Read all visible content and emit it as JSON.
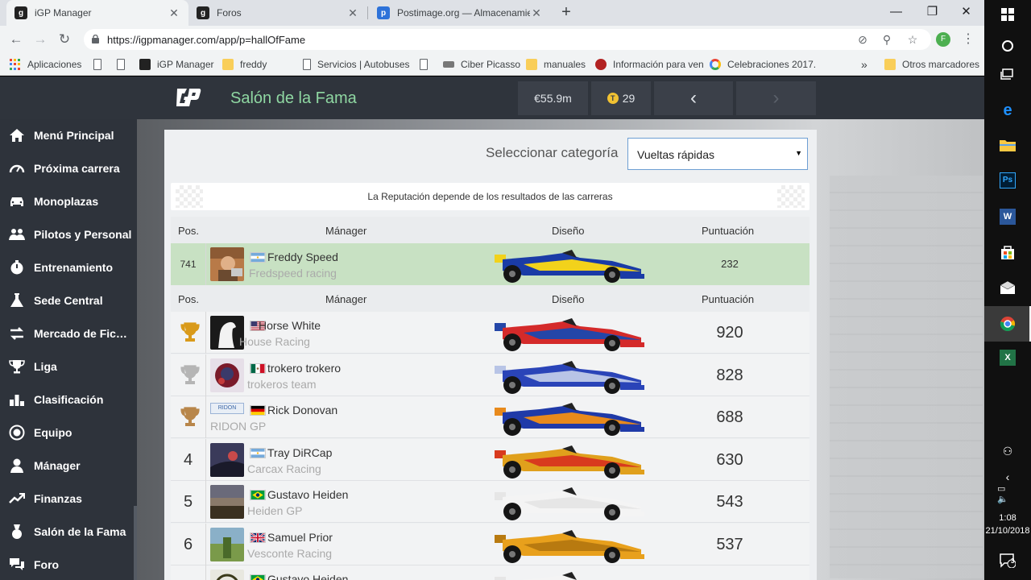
{
  "browser": {
    "tabs": [
      {
        "title": "iGP Manager",
        "favicon": "igp-favicon",
        "active": true
      },
      {
        "title": "Foros",
        "favicon": "igp-favicon",
        "active": false
      },
      {
        "title": "Postimage.org — Almacenamiento",
        "favicon": "postimage-favicon",
        "active": false
      }
    ],
    "url": "https://igpmanager.com/app/p=hallOfFame",
    "profile_initial": "F",
    "bookmarks": [
      {
        "label": "Aplicaciones",
        "icon": "apps-icon"
      },
      {
        "label": "",
        "icon": "page-icon"
      },
      {
        "label": "",
        "icon": "page-icon"
      },
      {
        "label": "iGP Manager",
        "icon": "igp-favicon"
      },
      {
        "label": "freddy",
        "icon": "folder-icon"
      },
      {
        "label": "Servicios | Autobuses",
        "icon": "page-icon"
      },
      {
        "label": "",
        "icon": "page-icon"
      },
      {
        "label": "Ciber Picasso",
        "icon": "site-icon"
      },
      {
        "label": "manuales",
        "icon": "folder-icon"
      },
      {
        "label": "Información para ven",
        "icon": "site-icon"
      },
      {
        "label": "Celebraciones 2017.",
        "icon": "google-icon"
      }
    ],
    "bookmarks_more": "»",
    "other_bookmarks": "Otros marcadores"
  },
  "site": {
    "title": "Salón de la Fama",
    "money": "€55.9m",
    "tokens": "29",
    "coin_symbol": "T",
    "prev_arrow": "‹",
    "next_arrow": "›"
  },
  "sidebar": {
    "items": [
      {
        "label": "Menú Principal",
        "icon": "home-icon"
      },
      {
        "label": "Próxima carrera",
        "icon": "speedometer-icon"
      },
      {
        "label": "Monoplazas",
        "icon": "car-icon"
      },
      {
        "label": "Pilotos y Personal",
        "icon": "people-icon"
      },
      {
        "label": "Entrenamiento",
        "icon": "stopwatch-icon"
      },
      {
        "label": "Sede Central",
        "icon": "flask-icon"
      },
      {
        "label": "Mercado de Fichajes",
        "icon": "transfer-icon"
      },
      {
        "label": "Liga",
        "icon": "trophy-icon"
      },
      {
        "label": "Clasificación",
        "icon": "bar-chart-icon"
      },
      {
        "label": "Equipo",
        "icon": "target-icon"
      },
      {
        "label": "Mánager",
        "icon": "user-icon"
      },
      {
        "label": "Finanzas",
        "icon": "trend-icon"
      },
      {
        "label": "Salón de la Fama",
        "icon": "medal-icon"
      },
      {
        "label": "Foro",
        "icon": "forum-icon"
      }
    ]
  },
  "hall": {
    "category_label": "Seleccionar categoría",
    "category_value": "Vueltas rápidas",
    "banner": "La Reputación depende de los resultados de las carreras",
    "headers": {
      "pos": "Pos.",
      "manager": "Mánager",
      "design": "Diseño",
      "score": "Puntuación"
    },
    "my_row": {
      "pos": "741",
      "manager": "Freddy Speed",
      "team": "Fredspeed racing",
      "flag": "argentina",
      "score": "232",
      "car_colors": {
        "body": "#1a3ba6",
        "accent": "#f2d21b",
        "nose": "#1a3ba6"
      }
    },
    "rows": [
      {
        "pos": "",
        "trophy": "gold",
        "manager": "Horse White",
        "team": "House Racing",
        "flag": "usa",
        "score": "920",
        "car_colors": {
          "body": "#d42a2a",
          "accent": "#2446a8",
          "nose": "#d42a2a"
        }
      },
      {
        "pos": "",
        "trophy": "silver",
        "manager": "trokero trokero",
        "team": "trokeros team",
        "flag": "mexico",
        "score": "828",
        "car_colors": {
          "body": "#2a44b8",
          "accent": "#b8c4e6",
          "nose": "#2a44b8"
        }
      },
      {
        "pos": "",
        "trophy": "bronze",
        "manager": "Rick Donovan",
        "team": "RIDON GP",
        "flag": "germany",
        "score": "688",
        "car_colors": {
          "body": "#1f3aa8",
          "accent": "#e88a1c",
          "nose": "#1f3aa8"
        }
      },
      {
        "pos": "4",
        "trophy": "",
        "manager": "Tray DiRCap",
        "team": "Carcax Racing",
        "flag": "argentina",
        "score": "630",
        "car_colors": {
          "body": "#e0a01c",
          "accent": "#d83a1e",
          "nose": "#e0a01c"
        }
      },
      {
        "pos": "5",
        "trophy": "",
        "manager": "Gustavo Heiden",
        "team": "Heiden GP",
        "flag": "brazil",
        "score": "543",
        "car_colors": {
          "body": "#f4f4f4",
          "accent": "#e6e6e6",
          "nose": "#f4f4f4"
        }
      },
      {
        "pos": "6",
        "trophy": "",
        "manager": "Samuel Prior",
        "team": "Vesconte Racing",
        "flag": "uk",
        "score": "537",
        "car_colors": {
          "body": "#e8a01c",
          "accent": "#b87a10",
          "nose": "#e8a01c"
        }
      },
      {
        "pos": "",
        "trophy": "",
        "manager": "Gustavo Heiden",
        "team": "",
        "flag": "brazil",
        "score": "",
        "car_colors": {
          "body": "#f4f4f4",
          "accent": "#e6e6e6",
          "nose": "#f4f4f4"
        }
      }
    ],
    "team_logo_text": "RIDON"
  },
  "taskbar": {
    "time": "1:08",
    "date": "21/10/2018",
    "notifications": "3"
  }
}
